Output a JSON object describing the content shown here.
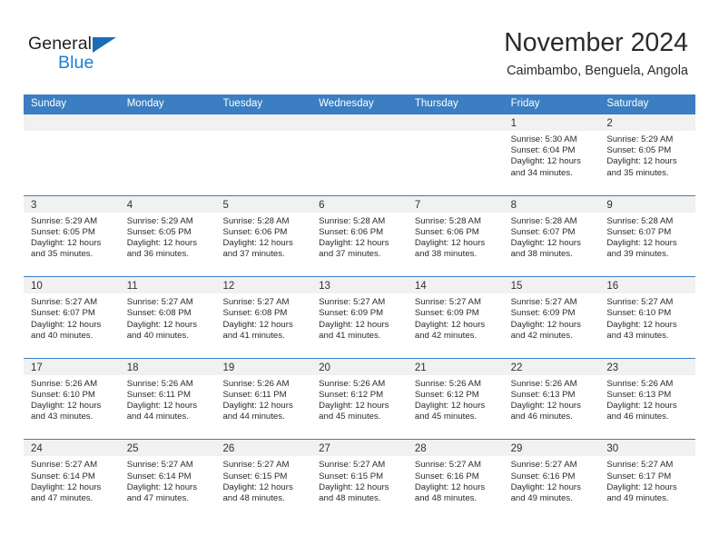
{
  "brand": {
    "name_part1": "General",
    "name_part2": "Blue",
    "color_dark": "#231f20",
    "color_blue": "#1a7fd4",
    "triangle_color": "#1b6cb5"
  },
  "header": {
    "month_title": "November 2024",
    "location": "Caimbambo, Benguela, Angola"
  },
  "theme": {
    "header_bar": "#3b7ec1",
    "day_band": "#f1f1f1",
    "row_divider": "#3b7ec1",
    "text": "#2b2b2b"
  },
  "calendar": {
    "weekday_headers": [
      "Sunday",
      "Monday",
      "Tuesday",
      "Wednesday",
      "Thursday",
      "Friday",
      "Saturday"
    ],
    "weeks": [
      [
        {
          "day": "",
          "sunrise": "",
          "sunset": "",
          "daylight_line1": "",
          "daylight_line2": ""
        },
        {
          "day": "",
          "sunrise": "",
          "sunset": "",
          "daylight_line1": "",
          "daylight_line2": ""
        },
        {
          "day": "",
          "sunrise": "",
          "sunset": "",
          "daylight_line1": "",
          "daylight_line2": ""
        },
        {
          "day": "",
          "sunrise": "",
          "sunset": "",
          "daylight_line1": "",
          "daylight_line2": ""
        },
        {
          "day": "",
          "sunrise": "",
          "sunset": "",
          "daylight_line1": "",
          "daylight_line2": ""
        },
        {
          "day": "1",
          "sunrise": "Sunrise: 5:30 AM",
          "sunset": "Sunset: 6:04 PM",
          "daylight_line1": "Daylight: 12 hours",
          "daylight_line2": "and 34 minutes."
        },
        {
          "day": "2",
          "sunrise": "Sunrise: 5:29 AM",
          "sunset": "Sunset: 6:05 PM",
          "daylight_line1": "Daylight: 12 hours",
          "daylight_line2": "and 35 minutes."
        }
      ],
      [
        {
          "day": "3",
          "sunrise": "Sunrise: 5:29 AM",
          "sunset": "Sunset: 6:05 PM",
          "daylight_line1": "Daylight: 12 hours",
          "daylight_line2": "and 35 minutes."
        },
        {
          "day": "4",
          "sunrise": "Sunrise: 5:29 AM",
          "sunset": "Sunset: 6:05 PM",
          "daylight_line1": "Daylight: 12 hours",
          "daylight_line2": "and 36 minutes."
        },
        {
          "day": "5",
          "sunrise": "Sunrise: 5:28 AM",
          "sunset": "Sunset: 6:06 PM",
          "daylight_line1": "Daylight: 12 hours",
          "daylight_line2": "and 37 minutes."
        },
        {
          "day": "6",
          "sunrise": "Sunrise: 5:28 AM",
          "sunset": "Sunset: 6:06 PM",
          "daylight_line1": "Daylight: 12 hours",
          "daylight_line2": "and 37 minutes."
        },
        {
          "day": "7",
          "sunrise": "Sunrise: 5:28 AM",
          "sunset": "Sunset: 6:06 PM",
          "daylight_line1": "Daylight: 12 hours",
          "daylight_line2": "and 38 minutes."
        },
        {
          "day": "8",
          "sunrise": "Sunrise: 5:28 AM",
          "sunset": "Sunset: 6:07 PM",
          "daylight_line1": "Daylight: 12 hours",
          "daylight_line2": "and 38 minutes."
        },
        {
          "day": "9",
          "sunrise": "Sunrise: 5:28 AM",
          "sunset": "Sunset: 6:07 PM",
          "daylight_line1": "Daylight: 12 hours",
          "daylight_line2": "and 39 minutes."
        }
      ],
      [
        {
          "day": "10",
          "sunrise": "Sunrise: 5:27 AM",
          "sunset": "Sunset: 6:07 PM",
          "daylight_line1": "Daylight: 12 hours",
          "daylight_line2": "and 40 minutes."
        },
        {
          "day": "11",
          "sunrise": "Sunrise: 5:27 AM",
          "sunset": "Sunset: 6:08 PM",
          "daylight_line1": "Daylight: 12 hours",
          "daylight_line2": "and 40 minutes."
        },
        {
          "day": "12",
          "sunrise": "Sunrise: 5:27 AM",
          "sunset": "Sunset: 6:08 PM",
          "daylight_line1": "Daylight: 12 hours",
          "daylight_line2": "and 41 minutes."
        },
        {
          "day": "13",
          "sunrise": "Sunrise: 5:27 AM",
          "sunset": "Sunset: 6:09 PM",
          "daylight_line1": "Daylight: 12 hours",
          "daylight_line2": "and 41 minutes."
        },
        {
          "day": "14",
          "sunrise": "Sunrise: 5:27 AM",
          "sunset": "Sunset: 6:09 PM",
          "daylight_line1": "Daylight: 12 hours",
          "daylight_line2": "and 42 minutes."
        },
        {
          "day": "15",
          "sunrise": "Sunrise: 5:27 AM",
          "sunset": "Sunset: 6:09 PM",
          "daylight_line1": "Daylight: 12 hours",
          "daylight_line2": "and 42 minutes."
        },
        {
          "day": "16",
          "sunrise": "Sunrise: 5:27 AM",
          "sunset": "Sunset: 6:10 PM",
          "daylight_line1": "Daylight: 12 hours",
          "daylight_line2": "and 43 minutes."
        }
      ],
      [
        {
          "day": "17",
          "sunrise": "Sunrise: 5:26 AM",
          "sunset": "Sunset: 6:10 PM",
          "daylight_line1": "Daylight: 12 hours",
          "daylight_line2": "and 43 minutes."
        },
        {
          "day": "18",
          "sunrise": "Sunrise: 5:26 AM",
          "sunset": "Sunset: 6:11 PM",
          "daylight_line1": "Daylight: 12 hours",
          "daylight_line2": "and 44 minutes."
        },
        {
          "day": "19",
          "sunrise": "Sunrise: 5:26 AM",
          "sunset": "Sunset: 6:11 PM",
          "daylight_line1": "Daylight: 12 hours",
          "daylight_line2": "and 44 minutes."
        },
        {
          "day": "20",
          "sunrise": "Sunrise: 5:26 AM",
          "sunset": "Sunset: 6:12 PM",
          "daylight_line1": "Daylight: 12 hours",
          "daylight_line2": "and 45 minutes."
        },
        {
          "day": "21",
          "sunrise": "Sunrise: 5:26 AM",
          "sunset": "Sunset: 6:12 PM",
          "daylight_line1": "Daylight: 12 hours",
          "daylight_line2": "and 45 minutes."
        },
        {
          "day": "22",
          "sunrise": "Sunrise: 5:26 AM",
          "sunset": "Sunset: 6:13 PM",
          "daylight_line1": "Daylight: 12 hours",
          "daylight_line2": "and 46 minutes."
        },
        {
          "day": "23",
          "sunrise": "Sunrise: 5:26 AM",
          "sunset": "Sunset: 6:13 PM",
          "daylight_line1": "Daylight: 12 hours",
          "daylight_line2": "and 46 minutes."
        }
      ],
      [
        {
          "day": "24",
          "sunrise": "Sunrise: 5:27 AM",
          "sunset": "Sunset: 6:14 PM",
          "daylight_line1": "Daylight: 12 hours",
          "daylight_line2": "and 47 minutes."
        },
        {
          "day": "25",
          "sunrise": "Sunrise: 5:27 AM",
          "sunset": "Sunset: 6:14 PM",
          "daylight_line1": "Daylight: 12 hours",
          "daylight_line2": "and 47 minutes."
        },
        {
          "day": "26",
          "sunrise": "Sunrise: 5:27 AM",
          "sunset": "Sunset: 6:15 PM",
          "daylight_line1": "Daylight: 12 hours",
          "daylight_line2": "and 48 minutes."
        },
        {
          "day": "27",
          "sunrise": "Sunrise: 5:27 AM",
          "sunset": "Sunset: 6:15 PM",
          "daylight_line1": "Daylight: 12 hours",
          "daylight_line2": "and 48 minutes."
        },
        {
          "day": "28",
          "sunrise": "Sunrise: 5:27 AM",
          "sunset": "Sunset: 6:16 PM",
          "daylight_line1": "Daylight: 12 hours",
          "daylight_line2": "and 48 minutes."
        },
        {
          "day": "29",
          "sunrise": "Sunrise: 5:27 AM",
          "sunset": "Sunset: 6:16 PM",
          "daylight_line1": "Daylight: 12 hours",
          "daylight_line2": "and 49 minutes."
        },
        {
          "day": "30",
          "sunrise": "Sunrise: 5:27 AM",
          "sunset": "Sunset: 6:17 PM",
          "daylight_line1": "Daylight: 12 hours",
          "daylight_line2": "and 49 minutes."
        }
      ]
    ]
  }
}
